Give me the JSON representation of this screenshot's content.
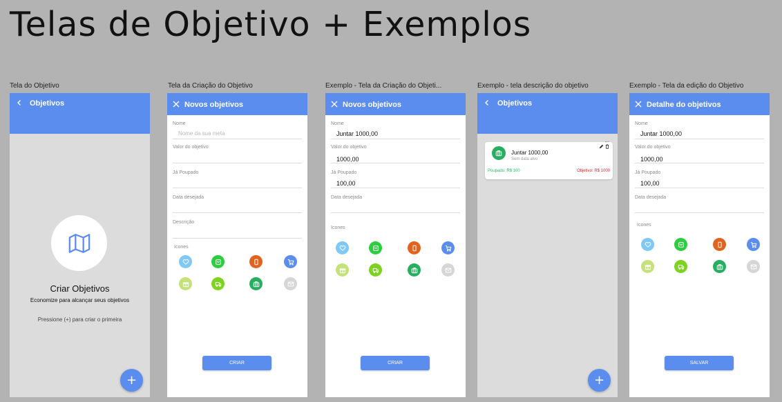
{
  "page_title": "Telas de Objetivo + Exemplos",
  "colors": {
    "primary": "#5b8def",
    "saved_green": "#2fb36b",
    "goal_red": "#e02020"
  },
  "screen1": {
    "label": "Tela do Objetivo",
    "header_title": "Objetivos",
    "empty_title": "Criar Objetivos",
    "empty_subtitle": "Economize para alcançar seus objetivos",
    "empty_hint": "Pressione (+) para criar o primeira",
    "fab": "+"
  },
  "screen2": {
    "label": "Tela da Criação do Objetivo",
    "header_title": "Novos objetivos",
    "f_nome": "Nome",
    "f_nome_placeholder": "Nome da sua meta",
    "f_valor": "Valor do objetivo",
    "f_poupado": "Já Poupado",
    "f_data": "Data desejada",
    "f_desc": "Descrição",
    "icons_label": "Icones",
    "button": "CRIAR"
  },
  "screen3": {
    "label": "Exemplo - Tela da Criação do Objeti...",
    "header_title": "Novos objetivos",
    "f_nome": "Nome",
    "v_nome": "Juntar 1000,00",
    "f_valor": "Valor do objetivo",
    "v_valor": "1000,00",
    "f_poupado": "Já Poupado",
    "v_poupado": "100,00",
    "f_data": "Data desejada",
    "icons_label": "Icones",
    "button": "CRIAR"
  },
  "screen4": {
    "label": "Exemplo - tela descrição do objetivo",
    "header_title": "Objetivos",
    "card_dots": "...",
    "card_title": "Juntar 1000,00",
    "card_subtitle": "Sem data alvo",
    "card_saved": "Poupado: R$ 100",
    "card_goal": "Objetivo: R$ 1000",
    "fab": "+"
  },
  "screen5": {
    "label": "Exemplo - Tela da edição do Objetivo",
    "header_title": "Detalhe do objetivos",
    "f_nome": "Nome",
    "v_nome": "Juntar 1000,00",
    "f_valor": "Valor do objetivo",
    "v_valor": "1000,00",
    "f_poupado": "Já Poupado",
    "v_poupado": "100,00",
    "f_data": "Data desejada",
    "icons_label": "Icones",
    "button": "SALVAR"
  },
  "icon_grid": [
    {
      "name": "heart-icon",
      "color": "#7fc8f8"
    },
    {
      "name": "shopping-bag-icon",
      "color": "#2ecc40"
    },
    {
      "name": "phone-icon",
      "color": "#e0641f"
    },
    {
      "name": "cart-icon",
      "color": "#5b8def"
    },
    {
      "name": "gift-icon",
      "color": "#c5e17a"
    },
    {
      "name": "truck-icon",
      "color": "#7ed321"
    },
    {
      "name": "briefcase-icon",
      "color": "#27ae60"
    },
    {
      "name": "mail-icon",
      "color": "#d6d6d6"
    }
  ]
}
